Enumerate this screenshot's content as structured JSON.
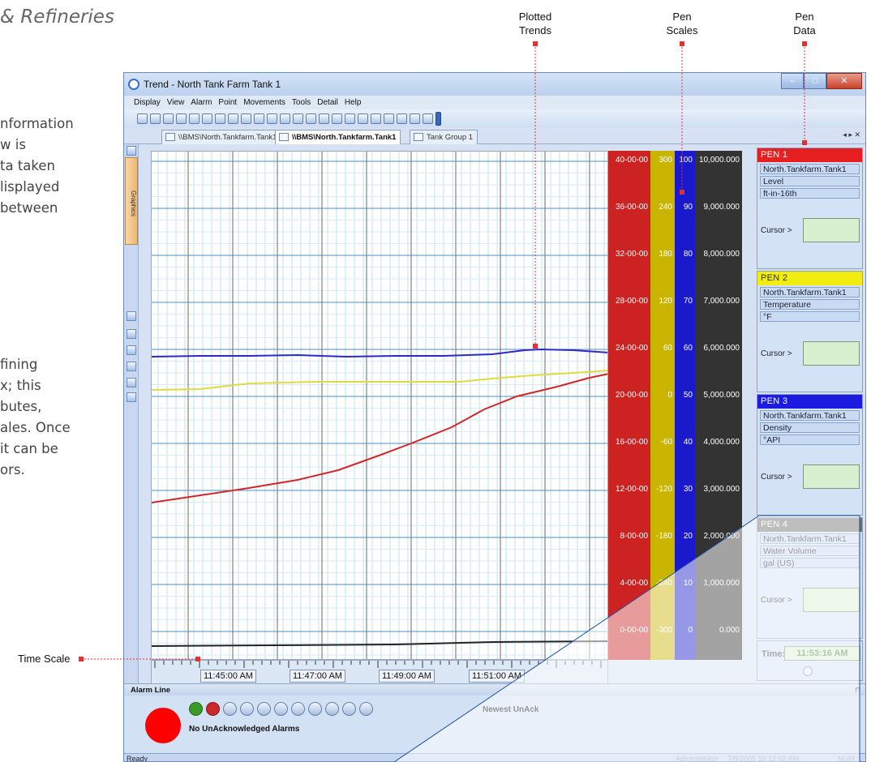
{
  "document": {
    "heading": "& Refineries",
    "para1": "nformation\nw is\nta taken\nlisplayed\nbetween",
    "para2": "fining\nx; this\nbutes,\nales. Once\nit can be\nors."
  },
  "callouts": {
    "plotted_trends": "Plotted\nTrends",
    "pen_scales": "Pen\nScales",
    "pen_data": "Pen\nData",
    "time_scale": "Time Scale"
  },
  "window": {
    "title": "Trend - North Tank Farm Tank 1",
    "menu": [
      "Display",
      "View",
      "Alarm",
      "Point",
      "Movements",
      "Tools",
      "Detail",
      "Help"
    ],
    "tabs": [
      "\\\\BMS\\North.Tankfarm.Tank1",
      "\\\\BMS\\North.Tankfarm.Tank1",
      "Tank Group 1"
    ],
    "tab_nav": "◂ ▸ ✕",
    "sidebar_label": "Graphics"
  },
  "scales": {
    "level": [
      "40-00-00",
      "36-00-00",
      "32-00-00",
      "28-00-00",
      "24-00-00",
      "20-00-00",
      "16-00-00",
      "12-00-00",
      "8-00-00",
      "4-00-00",
      "0-00-00"
    ],
    "temperature": [
      "300",
      "240",
      "180",
      "120",
      "60",
      "0",
      "-60",
      "-120",
      "-180",
      "-240",
      "-300"
    ],
    "density": [
      "100",
      "90",
      "80",
      "70",
      "60",
      "50",
      "40",
      "30",
      "20",
      "10",
      "0"
    ],
    "volume": [
      "10,000.000",
      "9,000.000",
      "8,000.000",
      "7,000.000",
      "6,000.000",
      "5,000.000",
      "4,000.000",
      "3,000.000",
      "2,000.000",
      "1,000.000",
      "0.000"
    ],
    "colors": {
      "level": "#cc2222",
      "temperature": "#c9b400",
      "density": "#1a1acc",
      "volume": "#333333"
    }
  },
  "time_axis": {
    "labels": [
      "11:45:00 AM",
      "11:47:00 AM",
      "11:49:00 AM",
      "11:51:00 AM"
    ]
  },
  "pens": [
    {
      "head": "PEN 1",
      "tag": "North.Tankfarm.Tank1",
      "attr": "Level",
      "unit": "ft-in-16th",
      "cursor": "Cursor >",
      "color": "#e62020"
    },
    {
      "head": "PEN 2",
      "tag": "North.Tankfarm.Tank1",
      "attr": "Temperature",
      "unit": "°F",
      "cursor": "Cursor >",
      "color": "#f2ec10"
    },
    {
      "head": "PEN 3",
      "tag": "North.Tankfarm.Tank1",
      "attr": "Density",
      "unit": "°API",
      "cursor": "Cursor >",
      "color": "#1c1ce0"
    },
    {
      "head": "PEN 4",
      "tag": "North.Tankfarm.Tank1",
      "attr": "Water Volume",
      "unit": "gal (US)",
      "cursor": "Cursor >",
      "color": "#707070"
    }
  ],
  "time_panel": {
    "label": "Time:",
    "value": "11:53:16 AM"
  },
  "alarm": {
    "header": "Alarm Line",
    "newest": "Newest UnAck",
    "no_alarms": "No UnAcknowledged Alarms"
  },
  "status": {
    "ready": "Ready",
    "user": "Administrator",
    "datetime": "7/8/2005 10:12:52 AM",
    "num": "NUM"
  }
}
